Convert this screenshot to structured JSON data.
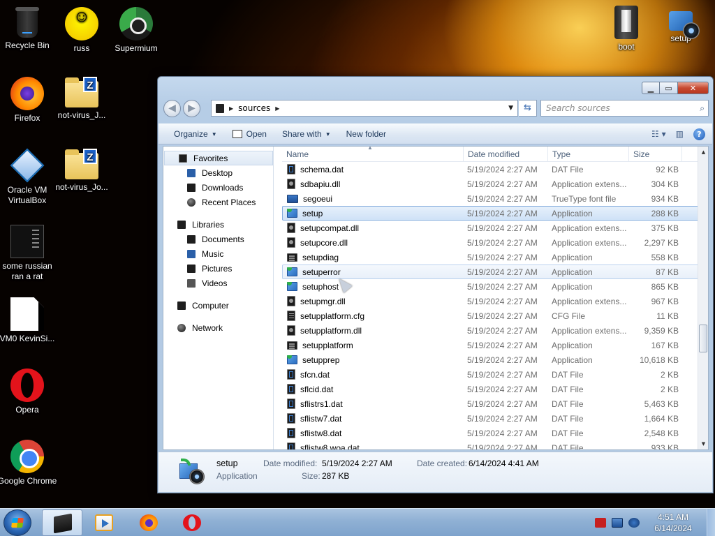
{
  "desktop": {
    "icons": [
      {
        "label": "Recycle Bin",
        "icon": "recycle-bin-icon"
      },
      {
        "label": "russ",
        "icon": "smiley-icon"
      },
      {
        "label": "Supermium",
        "icon": "supermium-icon"
      },
      {
        "label": "Firefox",
        "icon": "firefox-icon"
      },
      {
        "label": "not-virus_J...",
        "icon": "zip-folder-icon"
      },
      {
        "label": "Oracle VM VirtualBox",
        "icon": "virtualbox-icon"
      },
      {
        "label": "not-virus_Jo...",
        "icon": "zip-folder-icon"
      },
      {
        "label": "some russian ran a rat",
        "icon": "executable-icon"
      },
      {
        "label": "VM0 KevinSi...",
        "icon": "document-icon"
      },
      {
        "label": "Opera",
        "icon": "opera-icon"
      },
      {
        "label": "Google Chrome",
        "icon": "chrome-icon"
      },
      {
        "label": "boot",
        "icon": "boot-folder-icon"
      },
      {
        "label": "setup",
        "icon": "setup-icon"
      }
    ]
  },
  "window": {
    "breadcrumb": [
      "sources"
    ],
    "search_placeholder": "Search sources",
    "toolbar": {
      "organize": "Organize",
      "open": "Open",
      "share_with": "Share with",
      "new_folder": "New folder"
    },
    "nav": {
      "favorites": "Favorites",
      "desktop": "Desktop",
      "downloads": "Downloads",
      "recent_places": "Recent Places",
      "libraries": "Libraries",
      "documents": "Documents",
      "music": "Music",
      "pictures": "Pictures",
      "videos": "Videos",
      "computer": "Computer",
      "network": "Network"
    },
    "columns": {
      "name": "Name",
      "date_modified": "Date modified",
      "type": "Type",
      "size": "Size"
    },
    "files": [
      {
        "name": "schema.dat",
        "date": "5/19/2024 2:27 AM",
        "type": "DAT File",
        "size": "92 KB",
        "kind": "dat"
      },
      {
        "name": "sdbapiu.dll",
        "date": "5/19/2024 2:27 AM",
        "type": "Application extens...",
        "size": "304 KB",
        "kind": "dll"
      },
      {
        "name": "segoeui",
        "date": "5/19/2024 2:27 AM",
        "type": "TrueType font file",
        "size": "934 KB",
        "kind": "font"
      },
      {
        "name": "setup",
        "date": "5/19/2024 2:27 AM",
        "type": "Application",
        "size": "288 KB",
        "kind": "app",
        "state": "selected"
      },
      {
        "name": "setupcompat.dll",
        "date": "5/19/2024 2:27 AM",
        "type": "Application extens...",
        "size": "375 KB",
        "kind": "dll"
      },
      {
        "name": "setupcore.dll",
        "date": "5/19/2024 2:27 AM",
        "type": "Application extens...",
        "size": "2,297 KB",
        "kind": "dll"
      },
      {
        "name": "setupdiag",
        "date": "5/19/2024 2:27 AM",
        "type": "Application",
        "size": "558 KB",
        "kind": "cmd"
      },
      {
        "name": "setuperror",
        "date": "5/19/2024 2:27 AM",
        "type": "Application",
        "size": "87 KB",
        "kind": "app",
        "state": "hover"
      },
      {
        "name": "setuphost",
        "date": "5/19/2024 2:27 AM",
        "type": "Application",
        "size": "865 KB",
        "kind": "app"
      },
      {
        "name": "setupmgr.dll",
        "date": "5/19/2024 2:27 AM",
        "type": "Application extens...",
        "size": "967 KB",
        "kind": "dll"
      },
      {
        "name": "setupplatform.cfg",
        "date": "5/19/2024 2:27 AM",
        "type": "CFG File",
        "size": "11 KB",
        "kind": "cfg"
      },
      {
        "name": "setupplatform.dll",
        "date": "5/19/2024 2:27 AM",
        "type": "Application extens...",
        "size": "9,359 KB",
        "kind": "dll"
      },
      {
        "name": "setupplatform",
        "date": "5/19/2024 2:27 AM",
        "type": "Application",
        "size": "167 KB",
        "kind": "cmd"
      },
      {
        "name": "setupprep",
        "date": "5/19/2024 2:27 AM",
        "type": "Application",
        "size": "10,618 KB",
        "kind": "app"
      },
      {
        "name": "sfcn.dat",
        "date": "5/19/2024 2:27 AM",
        "type": "DAT File",
        "size": "2 KB",
        "kind": "dat"
      },
      {
        "name": "sflcid.dat",
        "date": "5/19/2024 2:27 AM",
        "type": "DAT File",
        "size": "2 KB",
        "kind": "dat"
      },
      {
        "name": "sflistrs1.dat",
        "date": "5/19/2024 2:27 AM",
        "type": "DAT File",
        "size": "5,463 KB",
        "kind": "dat"
      },
      {
        "name": "sflistw7.dat",
        "date": "5/19/2024 2:27 AM",
        "type": "DAT File",
        "size": "1,664 KB",
        "kind": "dat"
      },
      {
        "name": "sflistw8.dat",
        "date": "5/19/2024 2:27 AM",
        "type": "DAT File",
        "size": "2,548 KB",
        "kind": "dat"
      },
      {
        "name": "sflistw8.woa.dat",
        "date": "5/19/2024 2:27 AM",
        "type": "DAT File",
        "size": "933 KB",
        "kind": "dat"
      }
    ],
    "details": {
      "name": "setup",
      "type": "Application",
      "date_modified_label": "Date modified:",
      "date_modified": "5/19/2024 2:27 AM",
      "size_label": "Size:",
      "size": "287 KB",
      "date_created_label": "Date created:",
      "date_created": "6/14/2024 4:41 AM"
    }
  },
  "taskbar": {
    "time": "4:51 AM",
    "date": "6/14/2024"
  }
}
